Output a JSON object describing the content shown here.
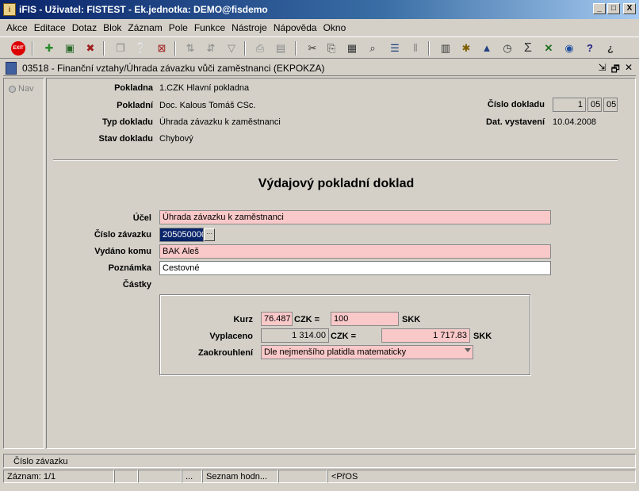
{
  "window": {
    "title": "iFIS - Uživatel: FISTEST - Ek.jednotka: DEMO@fisdemo",
    "minimize": "_",
    "maximize": "□",
    "close": "X"
  },
  "menu": [
    "Akce",
    "Editace",
    "Dotaz",
    "Blok",
    "Záznam",
    "Pole",
    "Funkce",
    "Nástroje",
    "Nápověda",
    "Okno"
  ],
  "toolbar": {
    "exit_label": "EXIT",
    "icons": [
      "exit-icon",
      "insert-record-icon",
      "save-record-icon",
      "delete-record-icon",
      "copy-icon",
      "query-icon",
      "query-execute-icon",
      "cancel-query-icon",
      "sort-asc-icon",
      "sort-desc-icon",
      "filter-icon",
      "print-icon",
      "print-preview-icon",
      "cut-icon",
      "copy-field-icon",
      "paste-icon",
      "find-icon",
      "list-icon",
      "split-icon",
      "calculator-icon",
      "tools-icon",
      "warning-icon",
      "clock-icon",
      "sum-icon",
      "excel-icon",
      "globe-icon",
      "help-icon",
      "context-help-icon"
    ]
  },
  "form": {
    "title": "03518 - Finanční vztahy/Úhrada závazku vůči zaměstnanci (EKPOKZA)",
    "ctrl_min": "⇲",
    "ctrl_restore": "🗗",
    "ctrl_close": "✕"
  },
  "nav": {
    "label": "Nav"
  },
  "header": {
    "pokladna_label": "Pokladna",
    "pokladna_value": "1.CZK Hlavní pokladna",
    "pokladni_label": "Pokladní",
    "pokladni_value": "Doc. Kalous Tomáš CSc.",
    "typ_label": "Typ dokladu",
    "typ_value": "Úhrada závazku k zaměstnanci",
    "stav_label": "Stav dokladu",
    "stav_value": "Chybový",
    "cislo_label": "Číslo dokladu",
    "cislo_part1": "1",
    "cislo_part2": "05",
    "cislo_part3": "05",
    "datum_label": "Dat. vystavení",
    "datum_value": "10.04.2008"
  },
  "doc_heading": "Výdajový pokladní doklad",
  "detail": {
    "ucel_label": "Účel",
    "ucel_value": "Úhrada závazku k zaměstnanci",
    "zavazek_label": "Číslo závazku",
    "zavazek_value": "205050000",
    "lov_label": "···",
    "vydano_label": "Vydáno komu",
    "vydano_value": "BAK Aleš",
    "poznamka_label": "Poznámka",
    "poznamka_value": "Cestovné"
  },
  "castky": {
    "group_label": "Částky",
    "kurz_label": "Kurz",
    "kurz_value": "76.487",
    "czk_eq_1": "CZK =",
    "kurz_base": "100",
    "skk_1": "SKK",
    "vyplaceno_label": "Vyplaceno",
    "vyplaceno_czk": "1 314.00",
    "czk_eq_2": "CZK =",
    "vyplaceno_skk": "1 717.83",
    "skk_2": "SKK",
    "zaokrouhleni_label": "Zaokrouhlení",
    "zaokrouhleni_value": "Dle nejmenšího platidla matematicky"
  },
  "status": {
    "hint": "Číslo závazku",
    "zaznam": "Záznam: 1/1",
    "dots": "...",
    "seznam": "Seznam hodn...",
    "mode": "<PřOS"
  }
}
